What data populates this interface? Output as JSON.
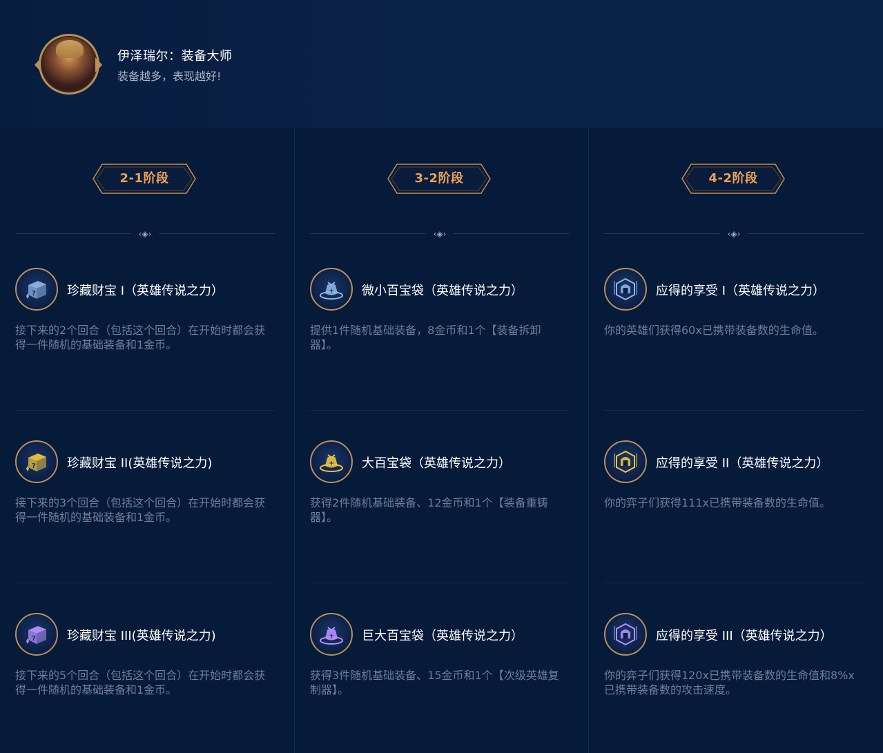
{
  "hero": {
    "title": "伊泽瑞尔：装备大师",
    "subtitle": "装备越多，表现越好!"
  },
  "columns": [
    {
      "stage": "2-1阶段",
      "items": [
        {
          "name": "珍藏财宝 I（英雄传说之力）",
          "desc": "接下来的2个回合（包括这个回合）在开始时都会获得一件随机的基础装备和1金币。",
          "icon": "treasure-box-icon",
          "color": "#8fb4e6"
        },
        {
          "name": "珍藏财宝 II(英雄传说之力)",
          "desc": "接下来的3个回合（包括这个回合）在开始时都会获得一件随机的基础装备和1金币。",
          "icon": "treasure-box-icon",
          "color": "#f0c33c"
        },
        {
          "name": "珍藏财宝 III(英雄传说之力)",
          "desc": "接下来的5个回合（包括这个回合）在开始时都会获得一件随机的基础装备和1金币。",
          "icon": "treasure-box-icon",
          "color": "#b690ff"
        }
      ]
    },
    {
      "stage": "3-2阶段",
      "items": [
        {
          "name": "微小百宝袋（英雄传说之力）",
          "desc": "提供1件随机基础装备，8金币和1个【装备拆卸器】。",
          "icon": "loot-bag-icon",
          "color": "#8fb4e6"
        },
        {
          "name": "大百宝袋（英雄传说之力）",
          "desc": "获得2件随机基础装备、12金币和1个【装备重铸器】。",
          "icon": "loot-bag-icon",
          "color": "#f0c33c"
        },
        {
          "name": "巨大百宝袋（英雄传说之力）",
          "desc": "获得3件随机基础装备、15金币和1个【次级英雄复制器】。",
          "icon": "loot-bag-icon",
          "color": "#b690ff"
        }
      ]
    },
    {
      "stage": "4-2阶段",
      "items": [
        {
          "name": "应得的享受 I（英雄传说之力）",
          "desc": "你的英雄们获得60x已携带装备数的生命值。",
          "icon": "helmet-icon",
          "color": "#8fb4e6"
        },
        {
          "name": "应得的享受 II（英雄传说之力）",
          "desc": "你的弈子们获得111x已携带装备数的生命值。",
          "icon": "helmet-icon",
          "color": "#f0c33c"
        },
        {
          "name": "应得的享受 III（英雄传说之力）",
          "desc": "你的弈子们获得120x已携带装备数的生命值和8%x已携带装备数的攻击速度。",
          "icon": "helmet-icon",
          "color": "#b690ff"
        }
      ]
    }
  ]
}
